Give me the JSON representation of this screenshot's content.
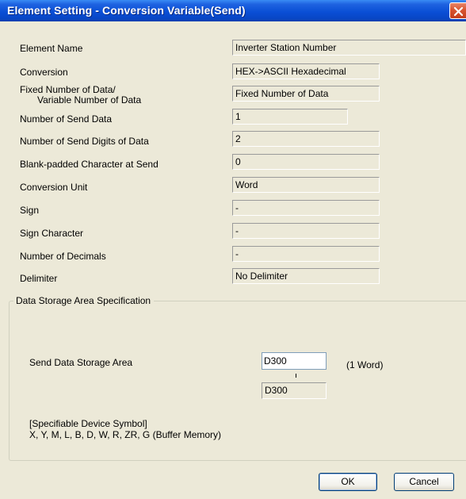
{
  "dialog": {
    "title": "Element Setting - Conversion Variable(Send)"
  },
  "fields": [
    {
      "label": "Element Name",
      "value": ""
    },
    {
      "label": "Conversion",
      "value": ""
    },
    {
      "label_line1": "Fixed Number of Data/",
      "label_line2": "Variable Number of Data",
      "value": ""
    },
    {
      "label": "Number of Send Data",
      "value": ""
    },
    {
      "label": "Number of Send Digits of  Data",
      "value": ""
    },
    {
      "label": "Blank-padded Character at Send",
      "value": ""
    },
    {
      "label": "Conversion Unit",
      "value": ""
    },
    {
      "label": "Sign",
      "value": ""
    },
    {
      "label": "Sign Character",
      "value": ""
    },
    {
      "label": "Number of Decimals",
      "value": ""
    },
    {
      "label": "Delimiter",
      "value": ""
    }
  ],
  "element_name": {
    "label": "Element Name",
    "value": "Inverter Station Number"
  },
  "conversion": {
    "label": "Conversion",
    "value": "HEX->ASCII Hexadecimal"
  },
  "fixed_variable": {
    "label_line1": "Fixed Number of Data/",
    "label_line2": "Variable Number of Data",
    "value": "Fixed Number of Data"
  },
  "send_data_count": {
    "label": "Number of Send Data",
    "value": "1"
  },
  "send_digits": {
    "label": "Number of Send Digits of  Data",
    "value": "2"
  },
  "blank_padded": {
    "label": "Blank-padded Character at Send",
    "value": "0"
  },
  "conversion_unit": {
    "label": "Conversion Unit",
    "value": "Word"
  },
  "sign": {
    "label": "Sign",
    "value": "-"
  },
  "sign_character": {
    "label": "Sign Character",
    "value": "-"
  },
  "decimals": {
    "label": "Number of Decimals",
    "value": "-"
  },
  "delimiter": {
    "label": "Delimiter",
    "value": "No Delimiter"
  },
  "storage": {
    "group_title": "Data Storage Area Specification",
    "send_area_label": "Send Data Storage Area",
    "send_area_value": "D300",
    "unit_note": "(1 Word)",
    "range_value": "D300",
    "device_symbol_title": "[Specifiable Device Symbol]",
    "device_symbol_list": "X, Y, M, L, B, D, W, R, ZR, G (Buffer Memory)"
  },
  "buttons": {
    "ok": "OK",
    "cancel": "Cancel"
  },
  "icons": {
    "close": "close-icon"
  },
  "colors": {
    "title_bar": "#0a4fd6",
    "close_button": "#d9542f",
    "dialog_bg": "#ece9d8"
  }
}
